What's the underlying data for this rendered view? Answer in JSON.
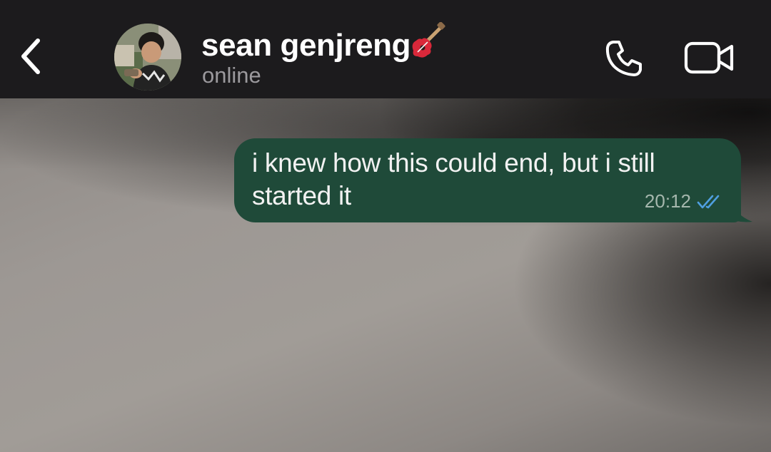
{
  "header": {
    "contact_name": "sean genjreng",
    "contact_status": "online",
    "name_emoji_icon": "guitar-icon",
    "back_icon": "chevron-left-icon",
    "call_icon": "phone-icon",
    "video_icon": "video-camera-icon"
  },
  "chat": {
    "messages": [
      {
        "direction": "outgoing",
        "text": "i knew how this could end, but i still started it",
        "time": "20:12",
        "status_icon": "double-check-icon",
        "status": "read"
      }
    ]
  },
  "colors": {
    "header_bg": "#1c1b1d",
    "outgoing_bubble": "#1f4a39",
    "read_tick": "#4f9fe0",
    "status_text": "#9b999d"
  }
}
